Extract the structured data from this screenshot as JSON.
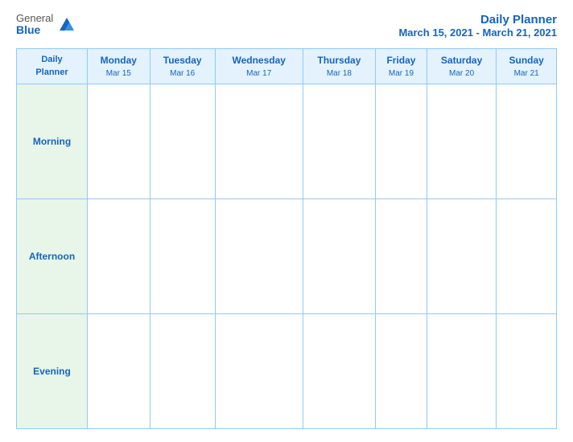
{
  "header": {
    "logo_general": "General",
    "logo_blue": "Blue",
    "title_main": "Daily Planner",
    "title_sub": "March 15, 2021 - March 21, 2021"
  },
  "table": {
    "header_label": "Daily\nPlanner",
    "days": [
      {
        "name": "Monday",
        "date": "Mar 15"
      },
      {
        "name": "Tuesday",
        "date": "Mar 16"
      },
      {
        "name": "Wednesday",
        "date": "Mar 17"
      },
      {
        "name": "Thursday",
        "date": "Mar 18"
      },
      {
        "name": "Friday",
        "date": "Mar 19"
      },
      {
        "name": "Saturday",
        "date": "Mar 20"
      },
      {
        "name": "Sunday",
        "date": "Mar 21"
      }
    ],
    "rows": [
      {
        "label": "Morning"
      },
      {
        "label": "Afternoon"
      },
      {
        "label": "Evening"
      }
    ]
  }
}
